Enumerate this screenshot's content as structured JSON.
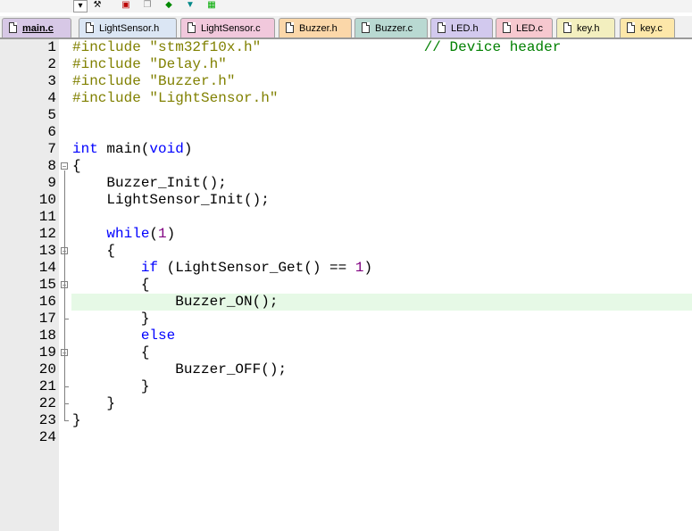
{
  "tabs": [
    {
      "label": "main.c",
      "color": "#d7c8e6",
      "active": true
    },
    {
      "label": "LightSensor.h",
      "color": "#dbe6f4"
    },
    {
      "label": "LightSensor.c",
      "color": "#f1c8dc"
    },
    {
      "label": "Buzzer.h",
      "color": "#fbd7a9"
    },
    {
      "label": "Buzzer.c",
      "color": "#b9d9d2"
    },
    {
      "label": "LED.h",
      "color": "#d2c9ee"
    },
    {
      "label": "LED.c",
      "color": "#f6c8cf"
    },
    {
      "label": "key.h",
      "color": "#f3efbf"
    },
    {
      "label": "key.c",
      "color": "#fde7a9"
    }
  ],
  "code_lines": [
    {
      "n": "1",
      "text": "#include \"stm32f10x.h\"                   // Device header"
    },
    {
      "n": "2",
      "text": "#include \"Delay.h\""
    },
    {
      "n": "3",
      "text": "#include \"Buzzer.h\""
    },
    {
      "n": "4",
      "text": "#include \"LightSensor.h\""
    },
    {
      "n": "5",
      "text": ""
    },
    {
      "n": "6",
      "text": ""
    },
    {
      "n": "7",
      "text": "int main(void)"
    },
    {
      "n": "8",
      "text": "{"
    },
    {
      "n": "9",
      "text": "    Buzzer_Init();"
    },
    {
      "n": "10",
      "text": "    LightSensor_Init();"
    },
    {
      "n": "11",
      "text": ""
    },
    {
      "n": "12",
      "text": "    while(1)"
    },
    {
      "n": "13",
      "text": "    {"
    },
    {
      "n": "14",
      "text": "        if (LightSensor_Get() == 1)"
    },
    {
      "n": "15",
      "text": "        {"
    },
    {
      "n": "16",
      "text": "            Buzzer_ON();"
    },
    {
      "n": "17",
      "text": "        }"
    },
    {
      "n": "18",
      "text": "        else"
    },
    {
      "n": "19",
      "text": "        {"
    },
    {
      "n": "20",
      "text": "            Buzzer_OFF();"
    },
    {
      "n": "21",
      "text": "        }"
    },
    {
      "n": "22",
      "text": "    }"
    },
    {
      "n": "23",
      "text": "}"
    },
    {
      "n": "24",
      "text": ""
    }
  ],
  "highlighted_line": "16",
  "fold_markers": [
    "8",
    "13",
    "15",
    "19"
  ],
  "colors": {
    "preprocessor": "#808000",
    "keyword": "#0000ff",
    "comment": "#008000",
    "number": "#800080",
    "current_line": "#e6f9e6"
  }
}
